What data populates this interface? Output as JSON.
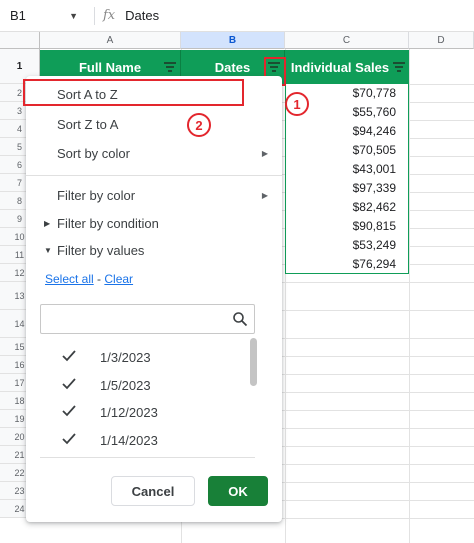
{
  "formula_bar": {
    "cell_ref": "B1",
    "fx_label": "fx",
    "value": "Dates"
  },
  "columns": [
    "A",
    "B",
    "C",
    "D"
  ],
  "rows": [
    "1",
    "2",
    "3",
    "4",
    "5",
    "6",
    "7",
    "8",
    "9",
    "10",
    "11",
    "12",
    "13",
    "14",
    "15",
    "16",
    "17",
    "18",
    "19",
    "20",
    "21",
    "22",
    "23",
    "24"
  ],
  "headers": {
    "full_name": "Full Name",
    "dates": "Dates",
    "individual_sales": "Individual Sales"
  },
  "sales": [
    "$70,778",
    "$55,760",
    "$94,246",
    "$70,505",
    "$43,001",
    "$97,339",
    "$82,462",
    "$90,815",
    "$53,249",
    "$76,294"
  ],
  "annotations": {
    "step1": "1",
    "step2": "2"
  },
  "menu": {
    "sort_a_z": "Sort A to Z",
    "sort_z_a": "Sort Z to A",
    "sort_by_color": "Sort by color",
    "filter_by_color": "Filter by color",
    "filter_by_condition": "Filter by condition",
    "filter_by_values": "Filter by values",
    "select_all": "Select all",
    "separator": " - ",
    "clear": "Clear",
    "search_placeholder": "",
    "values": [
      "1/3/2023",
      "1/5/2023",
      "1/12/2023",
      "1/14/2023"
    ],
    "cancel": "Cancel",
    "ok": "OK"
  },
  "colors": {
    "header_green": "#0f9d58",
    "ok_green": "#188038",
    "annotation_red": "#e3262d",
    "link_blue": "#1a73e8"
  }
}
